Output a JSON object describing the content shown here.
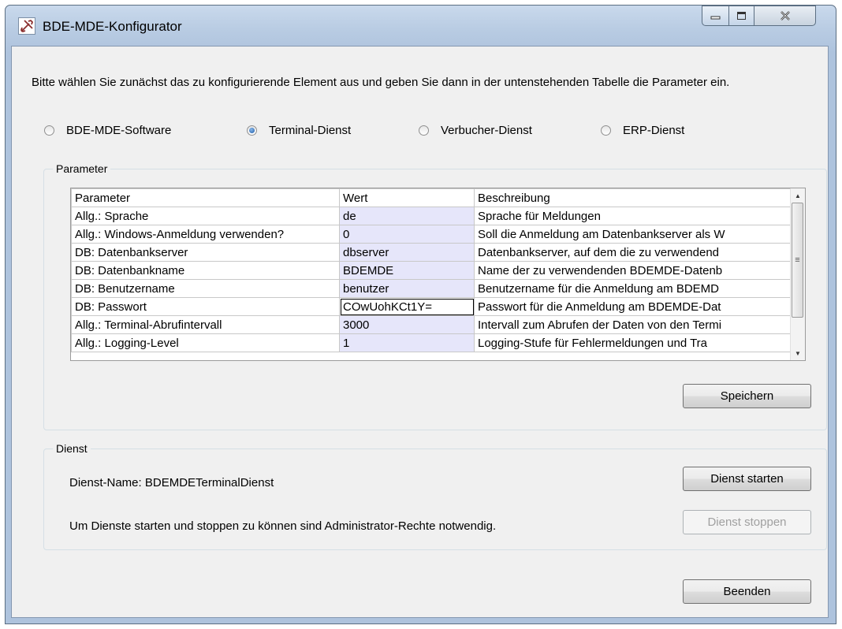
{
  "window": {
    "title": "BDE-MDE-Konfigurator",
    "controls": {
      "minimize": "—",
      "maximize": "☐",
      "close": "✕"
    }
  },
  "instruction": "Bitte wählen Sie zunächst das zu konfigurierende Element aus und geben Sie dann in der untenstehenden Tabelle die Parameter ein.",
  "radios": [
    {
      "label": "BDE-MDE-Software",
      "selected": false
    },
    {
      "label": "Terminal-Dienst",
      "selected": true
    },
    {
      "label": "Verbucher-Dienst",
      "selected": false
    },
    {
      "label": "ERP-Dienst",
      "selected": false
    }
  ],
  "parameter_group": {
    "label": "Parameter",
    "columns": [
      "Parameter",
      "Wert",
      "Beschreibung"
    ],
    "rows": [
      [
        "Allg.: Sprache",
        "de",
        "Sprache für Meldungen"
      ],
      [
        "Allg.: Windows-Anmeldung verwenden?",
        "0",
        "Soll die Anmeldung am Datenbankserver als W"
      ],
      [
        "DB: Datenbankserver",
        "dbserver",
        "Datenbankserver, auf dem die zu verwendend"
      ],
      [
        "DB: Datenbankname",
        "BDEMDE",
        "Name der zu verwendenden BDEMDE-Datenb"
      ],
      [
        "DB: Benutzername",
        "benutzer",
        "Benutzername für die Anmeldung am BDEMD"
      ],
      [
        "DB: Passwort",
        "COwUohKCt1Y=",
        "Passwort für die Anmeldung am BDEMDE-Dat"
      ],
      [
        "Allg.: Terminal-Abrufintervall",
        "3000",
        "Intervall zum Abrufen der Daten von den Termi"
      ],
      [
        "Allg.: Logging-Level",
        "1",
        "Logging-Stufe für Fehlermeldungen und Tra"
      ]
    ],
    "selected_row": 5,
    "save_label": "Speichern"
  },
  "service_group": {
    "label": "Dienst",
    "service_name": "Dienst-Name: BDEMDETerminalDienst",
    "note": "Um Dienste starten und stoppen zu können sind Administrator-Rechte notwendig.",
    "start_label": "Dienst starten",
    "stop_label": "Dienst stoppen"
  },
  "exit_label": "Beenden",
  "scrollbar": {
    "up": "▲",
    "down": "▼",
    "grip": "≡"
  }
}
